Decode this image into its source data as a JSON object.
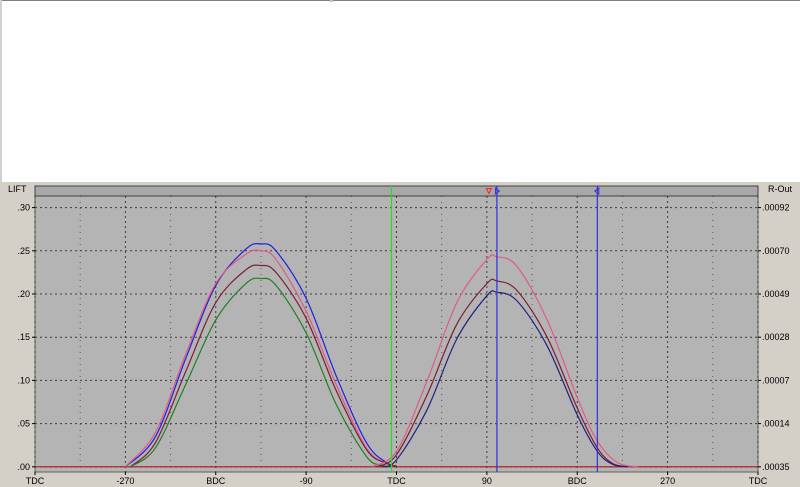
{
  "chart_data": {
    "type": "line",
    "left_axis_label": "LIFT",
    "right_axis_label": "R-Out",
    "x_tick_labels": [
      "TDC",
      "-270",
      "BDC",
      "-90",
      "TDC",
      "90",
      "BDC",
      "270",
      "TDC"
    ],
    "x_range": [
      -360,
      360
    ],
    "y_tick_labels": [
      ".00",
      ".05",
      ".10",
      ".15",
      ".20",
      ".25",
      ".30"
    ],
    "y_values": [
      0,
      0.05,
      0.1,
      0.15,
      0.2,
      0.25,
      0.3
    ],
    "ylim": [
      -0.006,
      0.325
    ],
    "right_tick_labels": [
      ".00035",
      ".00014",
      ".00007",
      ".00028",
      ".00049",
      ".00070",
      ".00092"
    ],
    "grid": true,
    "colors": {
      "plot_background": "#b4b4b4",
      "blue": "#2020e0",
      "pink": "#e05a8a",
      "brown": "#7a2030",
      "green": "#208020",
      "navy": "#202080",
      "baseline": "#b01818",
      "marker_green": "#20e020",
      "marker_blue": "#3030e0"
    },
    "series": [
      {
        "color": "blue",
        "x": [
          -270,
          -240,
          -210,
          -180,
          -150,
          -135,
          -120,
          -90,
          -60,
          -30,
          -10,
          0
        ],
        "y": [
          0,
          0.035,
          0.125,
          0.21,
          0.252,
          0.258,
          0.25,
          0.195,
          0.105,
          0.028,
          0.005,
          0.001
        ]
      },
      {
        "color": "pink",
        "x": [
          -270,
          -240,
          -210,
          -180,
          -150,
          -135,
          -120,
          -90,
          -60,
          -30,
          -10,
          0
        ],
        "y": [
          0,
          0.04,
          0.13,
          0.212,
          0.246,
          0.25,
          0.24,
          0.18,
          0.095,
          0.022,
          0.004,
          0.001
        ]
      },
      {
        "color": "brown",
        "x": [
          -265,
          -240,
          -210,
          -180,
          -150,
          -135,
          -120,
          -90,
          -60,
          -30,
          -10,
          0
        ],
        "y": [
          0,
          0.028,
          0.11,
          0.19,
          0.228,
          0.233,
          0.225,
          0.172,
          0.088,
          0.02,
          0.004,
          0.001
        ]
      },
      {
        "color": "green",
        "x": [
          -265,
          -240,
          -210,
          -180,
          -150,
          -135,
          -120,
          -90,
          -60,
          -30,
          -15,
          -5
        ],
        "y": [
          0,
          0.022,
          0.095,
          0.17,
          0.212,
          0.218,
          0.21,
          0.155,
          0.072,
          0.012,
          0.002,
          0
        ]
      },
      {
        "color": "pink",
        "x": [
          -25,
          0,
          30,
          60,
          90,
          100,
          120,
          150,
          180,
          200,
          220,
          240
        ],
        "y": [
          0,
          0.018,
          0.098,
          0.19,
          0.24,
          0.243,
          0.232,
          0.17,
          0.08,
          0.03,
          0.005,
          0
        ]
      },
      {
        "color": "brown",
        "x": [
          -20,
          0,
          30,
          60,
          90,
          100,
          120,
          150,
          180,
          200,
          215,
          230
        ],
        "y": [
          0,
          0.014,
          0.082,
          0.165,
          0.212,
          0.215,
          0.204,
          0.15,
          0.068,
          0.022,
          0.004,
          0
        ]
      },
      {
        "color": "navy",
        "x": [
          -15,
          0,
          30,
          60,
          90,
          100,
          120,
          150,
          180,
          200,
          215,
          230
        ],
        "y": [
          0,
          0.008,
          0.065,
          0.148,
          0.198,
          0.202,
          0.192,
          0.14,
          0.06,
          0.018,
          0.003,
          0
        ]
      }
    ],
    "vertical_markers": [
      {
        "x": -5,
        "color": "marker_green"
      },
      {
        "x": 100,
        "color": "marker_blue"
      },
      {
        "x": 200,
        "color": "marker_blue"
      }
    ],
    "top_flags": [
      {
        "x": 92,
        "color": "#ff2020",
        "shape": "down"
      },
      {
        "x": 100,
        "color": "#3030e0",
        "shape": "right"
      },
      {
        "x": 200,
        "color": "#3030e0",
        "shape": "left"
      }
    ]
  }
}
